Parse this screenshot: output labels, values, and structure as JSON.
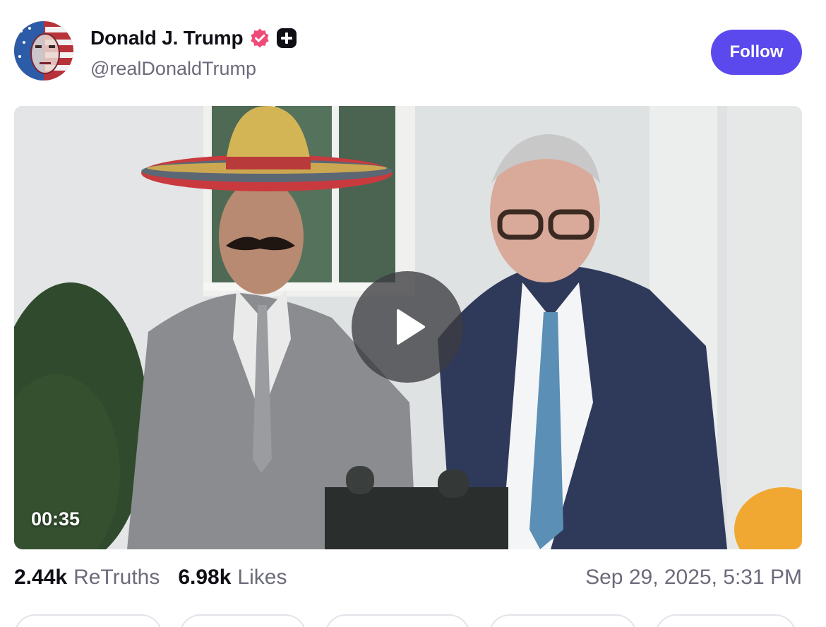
{
  "post": {
    "author": {
      "display_name": "Donald J. Trump",
      "handle": "@realDonaldTrump",
      "verified_icon": "verified-badge-icon",
      "plus_icon": "plus-badge-icon"
    },
    "follow_label": "Follow",
    "video": {
      "duration": "00:35",
      "play_icon": "play-icon"
    },
    "stats": {
      "retruths_count": "2.44k",
      "retruths_label": "ReTruths",
      "likes_count": "6.98k",
      "likes_label": "Likes",
      "timestamp": "Sep 29, 2025, 5:31 PM"
    }
  },
  "colors": {
    "accent": "#5b49ee",
    "verified": "#ef4a78",
    "text_primary": "#0f0f16",
    "text_secondary": "#6b6b7b"
  }
}
